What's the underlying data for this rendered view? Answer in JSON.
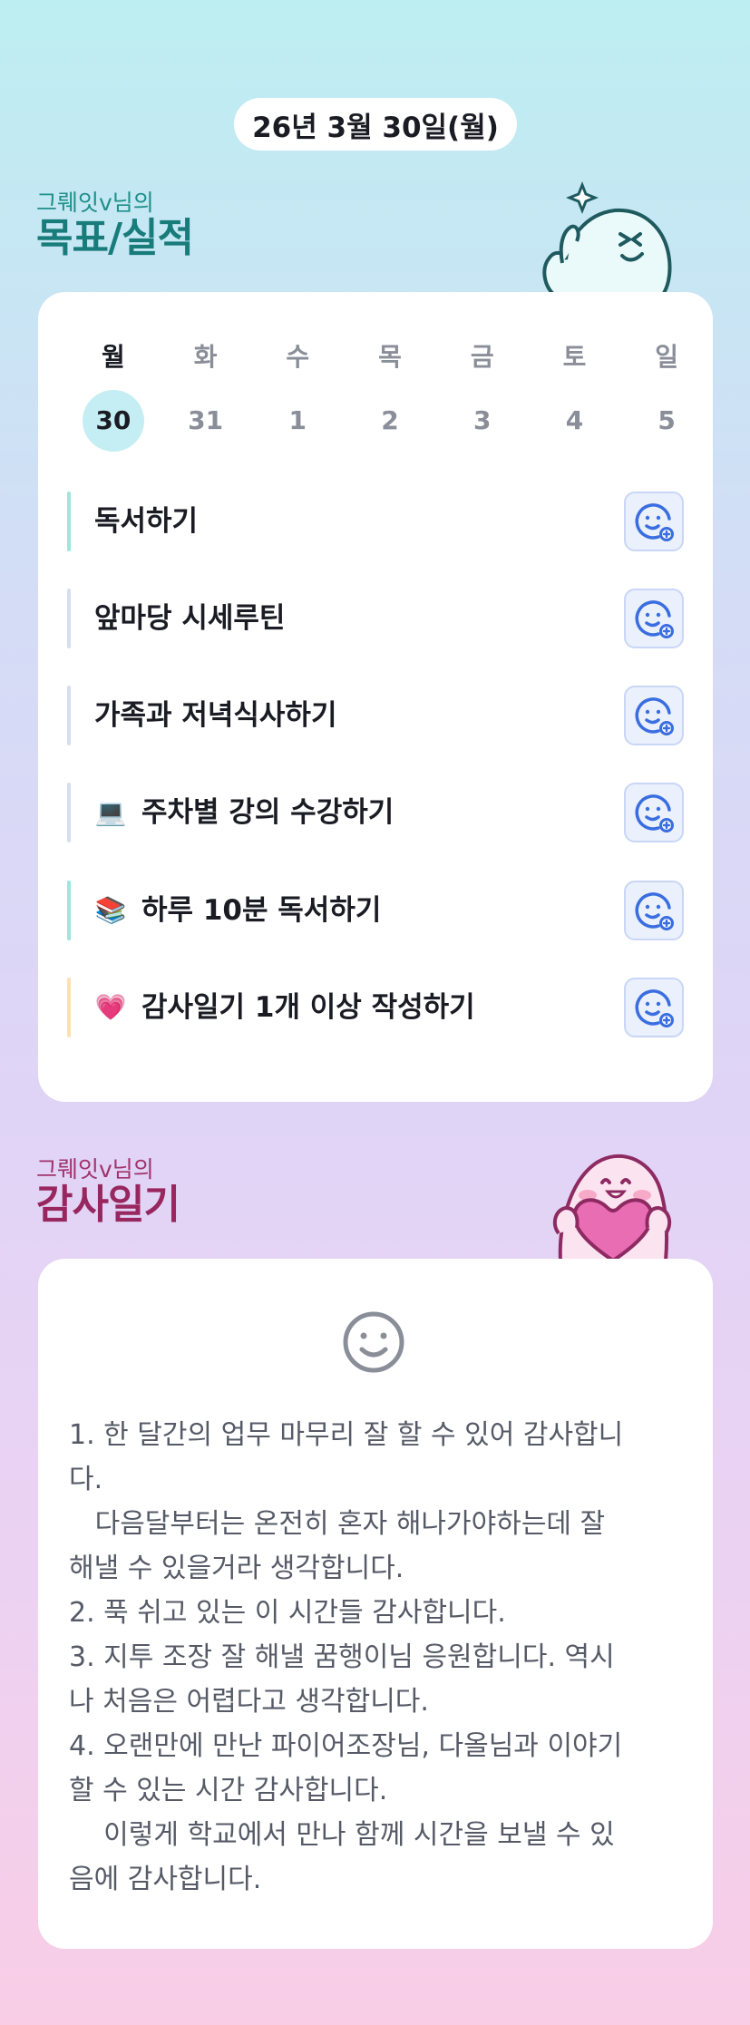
{
  "header": {
    "date": "26년 3월 30일(월)"
  },
  "goals_section": {
    "subtitle": "그뤠잇v님의",
    "title": "목표/실적",
    "week": [
      {
        "day": "월",
        "date": "30",
        "active": true
      },
      {
        "day": "화",
        "date": "31",
        "active": false
      },
      {
        "day": "수",
        "date": "1",
        "active": false
      },
      {
        "day": "목",
        "date": "2",
        "active": false
      },
      {
        "day": "금",
        "date": "3",
        "active": false
      },
      {
        "day": "토",
        "date": "4",
        "active": false
      },
      {
        "day": "일",
        "date": "5",
        "active": false
      }
    ],
    "goals": [
      {
        "text": "독서하기",
        "emoji": "",
        "bar_color": "#9fe5dc"
      },
      {
        "text": "앞마당 시세루틴",
        "emoji": "",
        "bar_color": "#d6def0"
      },
      {
        "text": "가족과 저녁식사하기",
        "emoji": "",
        "bar_color": "#d6def0"
      },
      {
        "text": "주차별 강의 수강하기",
        "emoji": "💻",
        "bar_color": "#d6def0"
      },
      {
        "text": "하루 10분 독서하기",
        "emoji": "📚",
        "bar_color": "#9fe5dc"
      },
      {
        "text": "감사일기 1개 이상 작성하기",
        "emoji": "💗",
        "bar_color": "#fbe0b4"
      }
    ],
    "reaction_icon": "smile-face-add-icon"
  },
  "gratitude_section": {
    "subtitle": "그뤠잇v님의",
    "title": "감사일기",
    "face_icon": "smile-face-icon",
    "body": "1. 한 달간의 업무 마무리 잘 할 수 있어 감사합니\n다.\n   다음달부터는 온전히 혼자 해나가야하는데 잘\n해낼 수 있을거라 생각합니다.\n2. 푹 쉬고 있는 이 시간들 감사합니다.\n3. 지투 조장 잘 해낼 꿈행이님 응원합니다. 역시\n나 처음은 어렵다고 생각합니다.\n4. 오랜만에 만난 파이어조장님, 다올님과 이야기\n할 수 있는 시간 감사합니다.\n    이렇게 학교에서 만나 함께 시간을 보낼 수 있\n음에 감사합니다."
  },
  "colors": {
    "goals_title": "#187c7a",
    "gratitude_title": "#98275f",
    "active_day": "#c4eef3",
    "reaction_icon": "#3a6ee0"
  }
}
